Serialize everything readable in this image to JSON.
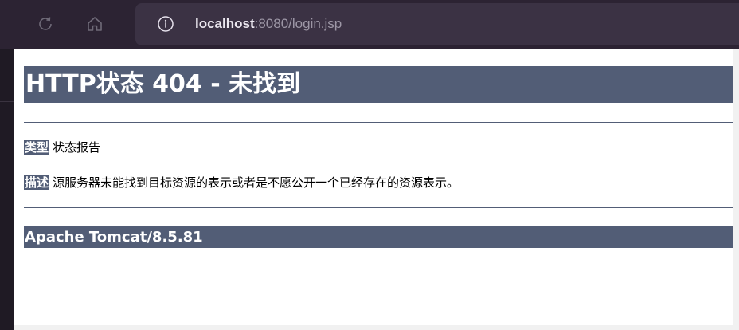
{
  "browser": {
    "url_host": "localhost",
    "url_rest": ":8080/login.jsp",
    "icons": {
      "reload": "reload-icon",
      "home": "home-icon",
      "info": "info-icon"
    }
  },
  "page": {
    "heading": "HTTP状态 404 - 未找到",
    "type_label": "类型",
    "type_value": "状态报告",
    "description_label": "描述",
    "description_value": "源服务器未能找到目标资源的表示或者是不愿公开一个已经存在的资源表示。",
    "server_info": "Apache Tomcat/8.5.81"
  },
  "colors": {
    "tomcat_header_bg": "#525d76",
    "toolbar_bg": "#2c2333",
    "address_bar_bg": "#3b3244"
  }
}
